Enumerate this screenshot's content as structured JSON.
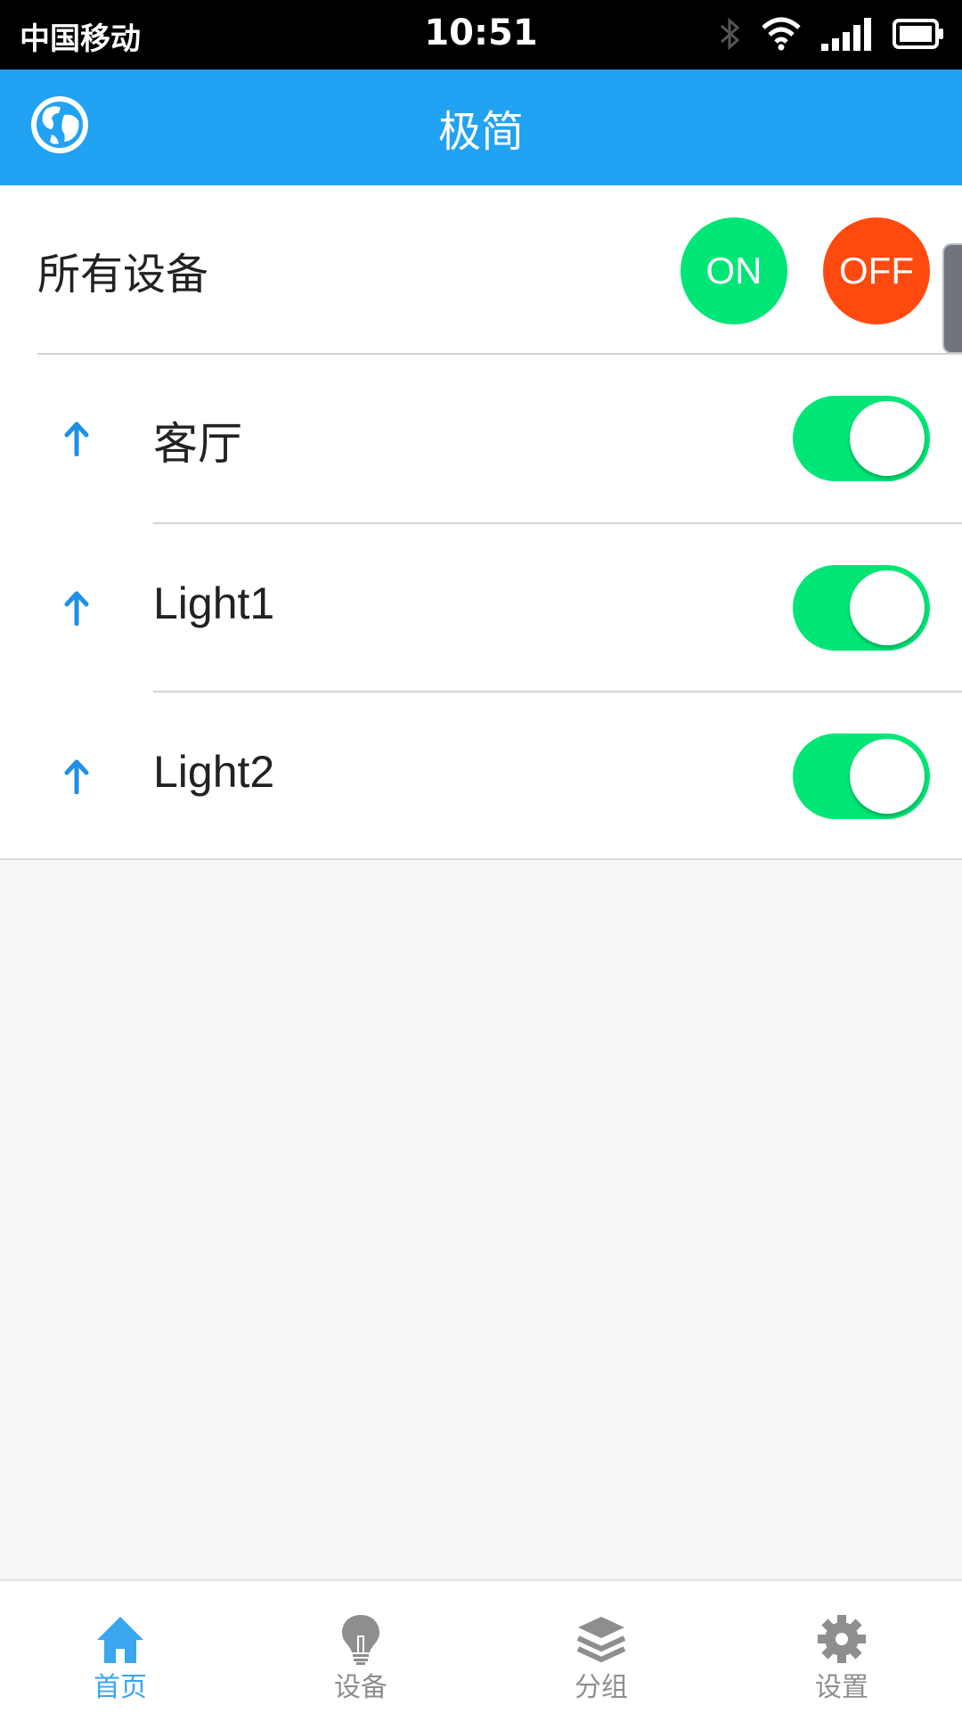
{
  "status_bar": {
    "carrier": "中国移动",
    "time": "10:51",
    "icons": [
      "bluetooth-icon",
      "wifi-icon",
      "signal-icon",
      "battery-icon"
    ]
  },
  "header": {
    "title": "极简",
    "left_icon": "globe-icon"
  },
  "all_devices": {
    "label": "所有设备",
    "on_label": "ON",
    "off_label": "OFF"
  },
  "devices": [
    {
      "name": "客厅",
      "state": "on",
      "icon": "arrow-up-icon"
    },
    {
      "name": "Light1",
      "state": "on",
      "icon": "arrow-up-icon"
    },
    {
      "name": "Light2",
      "state": "on",
      "icon": "arrow-up-icon"
    }
  ],
  "tabs": [
    {
      "label": "首页",
      "icon": "home-icon",
      "active": true
    },
    {
      "label": "设备",
      "icon": "bulb-icon",
      "active": false
    },
    {
      "label": "分组",
      "icon": "layers-icon",
      "active": false
    },
    {
      "label": "设置",
      "icon": "gear-icon",
      "active": false
    }
  ],
  "colors": {
    "header": "#22a2f2",
    "on": "#00e676",
    "off": "#ff4a0f",
    "tab_active": "#3aa6ef",
    "tab_inactive": "#8e8e8e"
  }
}
